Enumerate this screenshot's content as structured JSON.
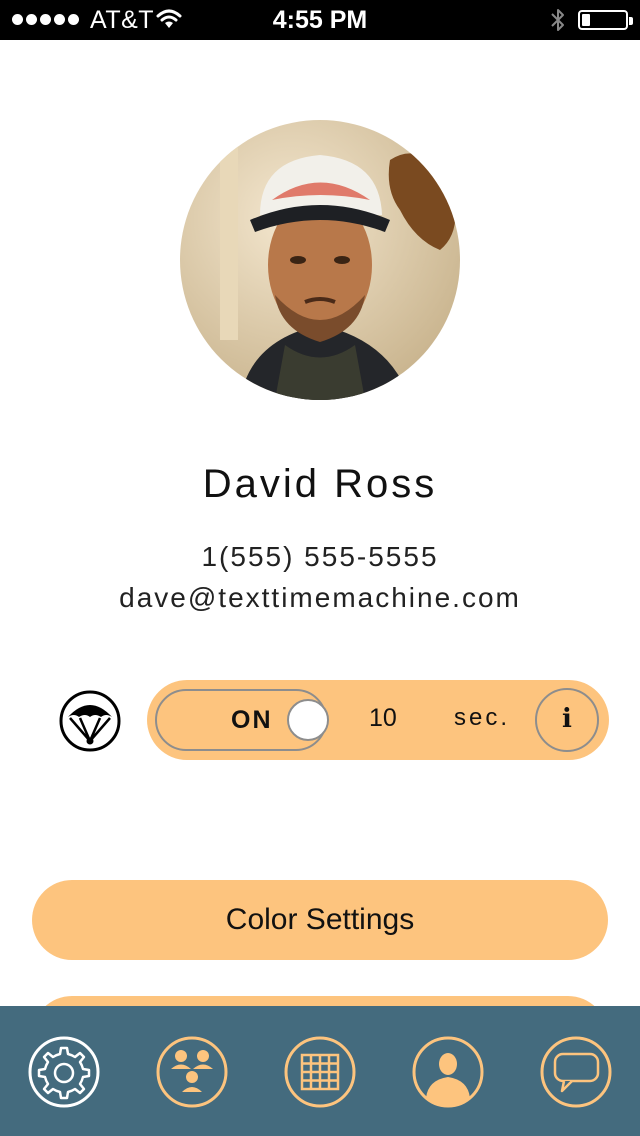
{
  "status_bar": {
    "carrier": "AT&T",
    "time": "4:55 PM",
    "battery_level": 0.18,
    "signal_bars": 5
  },
  "profile": {
    "name": "David Ross",
    "phone": "1(555) 555-5555",
    "email": "dave@texttimemachine.com"
  },
  "timer": {
    "toggle_label": "ON",
    "toggle_state": "on",
    "seconds_value": "10",
    "unit_label": "sec.",
    "info_label": "i"
  },
  "buttons": {
    "color_settings": "Color Settings"
  },
  "tab_bar": {
    "items": [
      {
        "icon": "gear-icon",
        "active": true
      },
      {
        "icon": "group-icon",
        "active": false
      },
      {
        "icon": "grid-icon",
        "active": false
      },
      {
        "icon": "person-icon",
        "active": false
      },
      {
        "icon": "chat-bubble-icon",
        "active": false
      }
    ]
  },
  "colors": {
    "accent": "#fdc47e",
    "tab_bar": "#446b7e",
    "active_icon": "#ffffff"
  }
}
